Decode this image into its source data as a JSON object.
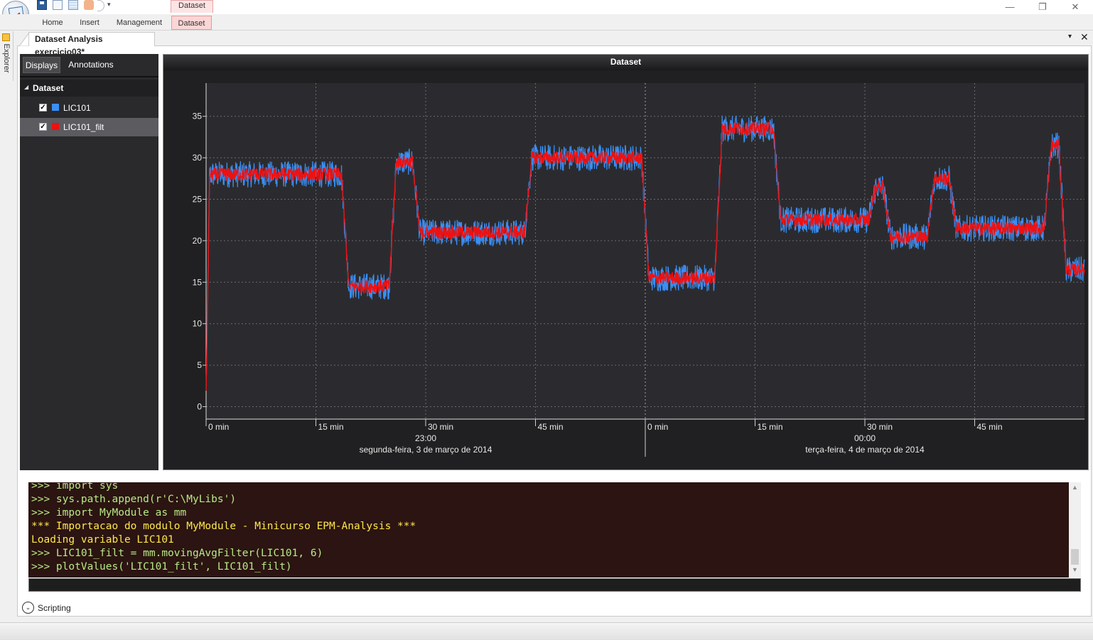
{
  "window": {
    "context_tab_header": "Dataset",
    "ribbon_tabs": [
      "Home",
      "Insert",
      "Management",
      "Dataset"
    ],
    "active_ribbon_tab": "Dataset",
    "minimize": "—",
    "restore": "❐",
    "close": "✕"
  },
  "explorer": {
    "label": "Explorer"
  },
  "document": {
    "tab_title": "Dataset Analysis exercicio03*",
    "menu_glyph": "▾",
    "close_glyph": "✕"
  },
  "left_panel": {
    "tabs": [
      "Displays",
      "Annotations"
    ],
    "active_tab": "Displays",
    "tree": {
      "root": "Dataset",
      "expander": "◢",
      "items": [
        {
          "label": "LIC101",
          "checked": true,
          "color": "#3a8ff5",
          "selected": false
        },
        {
          "label": "LIC101_filt",
          "checked": true,
          "color": "#ee1111",
          "selected": true
        }
      ]
    }
  },
  "chart_data": {
    "type": "line",
    "title": "Dataset",
    "ylabel": "",
    "xlabel": "",
    "ylim": [
      -1.5,
      39
    ],
    "yticks": [
      0,
      5,
      10,
      15,
      20,
      25,
      30,
      35
    ],
    "xlim_minutes": [
      0,
      120
    ],
    "x_ticks": [
      {
        "min": 0,
        "label": "0 min"
      },
      {
        "min": 15,
        "label": "15 min"
      },
      {
        "min": 30,
        "label": "30 min"
      },
      {
        "min": 45,
        "label": "45 min"
      },
      {
        "min": 60,
        "label": "0 min"
      },
      {
        "min": 75,
        "label": "15 min"
      },
      {
        "min": 90,
        "label": "30 min"
      },
      {
        "min": 105,
        "label": "45 min"
      }
    ],
    "x_major_labels": [
      {
        "min": 30,
        "time": "23:00",
        "date": "segunda-feira, 3 de março de 2014"
      },
      {
        "min": 90,
        "time": "00:00",
        "date": "terça-feira, 4 de março de 2014"
      }
    ],
    "day_separator_min": 60,
    "grid": true,
    "background": "#2b2b2f",
    "series": [
      {
        "name": "LIC101",
        "color": "#3a8ff5",
        "noise_band": 1.6,
        "levels": [
          [
            0,
            2.0
          ],
          [
            0.5,
            28.0
          ],
          [
            18.5,
            28.0
          ],
          [
            19.5,
            14.5
          ],
          [
            25.0,
            14.5
          ],
          [
            26.0,
            29.5
          ],
          [
            28.2,
            29.5
          ],
          [
            29.2,
            21.0
          ],
          [
            43.5,
            21.0
          ],
          [
            44.5,
            30.0
          ],
          [
            59.5,
            30.0
          ],
          [
            60.5,
            15.5
          ],
          [
            69.5,
            15.5
          ],
          [
            70.5,
            33.5
          ],
          [
            77.5,
            33.5
          ],
          [
            78.5,
            22.5
          ],
          [
            90.5,
            22.5
          ],
          [
            91.5,
            26.5
          ],
          [
            92.5,
            26.5
          ],
          [
            93.5,
            20.5
          ],
          [
            98.5,
            20.5
          ],
          [
            99.5,
            27.5
          ],
          [
            101.5,
            27.5
          ],
          [
            102.5,
            21.5
          ],
          [
            114.5,
            21.5
          ],
          [
            115.5,
            31.5
          ],
          [
            116.5,
            31.5
          ],
          [
            117.5,
            16.5
          ],
          [
            120,
            16.5
          ]
        ]
      },
      {
        "name": "LIC101_filt",
        "color": "#ee1111",
        "noise_band": 0.8,
        "levels": [
          [
            0,
            2.0
          ],
          [
            0.5,
            28.0
          ],
          [
            18.5,
            28.0
          ],
          [
            19.5,
            14.5
          ],
          [
            25.0,
            14.5
          ],
          [
            26.0,
            29.5
          ],
          [
            28.2,
            29.5
          ],
          [
            29.2,
            21.0
          ],
          [
            43.5,
            21.0
          ],
          [
            44.5,
            30.0
          ],
          [
            59.5,
            30.0
          ],
          [
            60.5,
            15.5
          ],
          [
            69.5,
            15.5
          ],
          [
            70.5,
            33.5
          ],
          [
            77.5,
            33.5
          ],
          [
            78.5,
            22.5
          ],
          [
            90.5,
            22.5
          ],
          [
            91.5,
            26.5
          ],
          [
            92.5,
            26.5
          ],
          [
            93.5,
            20.5
          ],
          [
            98.5,
            20.5
          ],
          [
            99.5,
            27.5
          ],
          [
            101.5,
            27.5
          ],
          [
            102.5,
            21.5
          ],
          [
            114.5,
            21.5
          ],
          [
            115.5,
            31.5
          ],
          [
            116.5,
            31.5
          ],
          [
            117.5,
            16.5
          ],
          [
            120,
            16.5
          ]
        ]
      }
    ]
  },
  "console": {
    "lines": [
      {
        "kind": "cmd",
        "text": ">>> import sys"
      },
      {
        "kind": "cmd",
        "text": ">>> sys.path.append(r'C:\\MyLibs')"
      },
      {
        "kind": "cmd",
        "text": ">>> import MyModule as mm"
      },
      {
        "kind": "out",
        "text": "*** Importacao do modulo MyModule - Minicurso EPM-Analysis ***"
      },
      {
        "kind": "out",
        "text": "Loading variable LIC101"
      },
      {
        "kind": "cmd",
        "text": ">>> LIC101_filt = mm.movingAvgFilter(LIC101, 6)"
      },
      {
        "kind": "cmd",
        "text": ">>> plotValues('LIC101_filt', LIC101_filt)"
      }
    ],
    "input_value": ""
  },
  "scripting": {
    "label": "Scripting",
    "toggle_glyph": "⌄"
  }
}
